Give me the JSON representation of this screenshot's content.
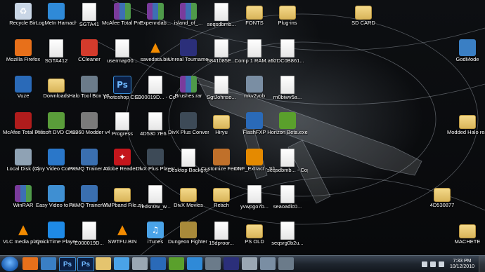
{
  "desktop_icons": [
    {
      "label": "Recycle Bin",
      "icon": "recycle-bin-icon",
      "color": "#c9d6e6"
    },
    {
      "label": "Mozilla Firefox",
      "icon": "firefox-icon",
      "color": "#e8701a"
    },
    {
      "label": "Vuze",
      "icon": "vuze-icon",
      "color": "#2a6ab8"
    },
    {
      "label": "McAfee Total Protection ...",
      "icon": "mcafee-icon",
      "color": "#b01c1c"
    },
    {
      "label": "Local Disk (C)",
      "icon": "drive-icon",
      "color": "#8fa2b4"
    },
    {
      "label": "WinRAR",
      "icon": "winrar-icon",
      "color": "#7a3b9c"
    },
    {
      "label": "VLC media player",
      "icon": "vlc-icon",
      "color": "#f28b00"
    },
    {
      "label": "LogMeIn Hamachi",
      "icon": "hamachi-icon",
      "color": "#2f8ad8"
    },
    {
      "label": "SGTA412",
      "icon": "file-icon",
      "color": "#ffffff"
    },
    {
      "label": "Downloads",
      "icon": "folder-icon",
      "color": "#e5c46e"
    },
    {
      "label": "Xilisoft DVD Creator 6",
      "icon": "dvd-icon",
      "color": "#5a9d3a"
    },
    {
      "label": "Any Video Converter ...",
      "icon": "video-converter-icon",
      "color": "#2a77c9"
    },
    {
      "label": "Easy Video to Audio Con...",
      "icon": "audio-converter-icon",
      "color": "#3f8fd2"
    },
    {
      "label": "QuickTime Player",
      "icon": "quicktime-icon",
      "color": "#1e8ae6"
    },
    {
      "label": "SGTA41",
      "icon": "file-icon",
      "color": "#ffffff"
    },
    {
      "label": "CCleaner",
      "icon": "ccleaner-icon",
      "color": "#d33b2c"
    },
    {
      "label": "Halo Tool Box V3.5",
      "icon": "halo-icon",
      "color": "#6b7b8a"
    },
    {
      "label": "X8360 Modder v4.0",
      "icon": "modder-icon",
      "color": "#7a7a7a"
    },
    {
      "label": "PKMQ Trainer XL",
      "icon": "trainer-icon",
      "color": "#3a6fb0"
    },
    {
      "label": "PKMQ Trainer XL",
      "icon": "trainer-icon",
      "color": "#3a6fb0"
    },
    {
      "label": "E000019D...",
      "icon": "file-icon",
      "color": "#ffffff"
    },
    {
      "label": "McAfee Total Protection ...",
      "icon": "winrar-icon",
      "color": "#7a3b9c"
    },
    {
      "label": "usermap00...",
      "icon": "file-icon",
      "color": "#ffffff"
    },
    {
      "label": "Photoshop CS3",
      "icon": "photoshop-icon",
      "color": "#0b1f44"
    },
    {
      "label": "Progress",
      "icon": "file-icon",
      "color": "#ffffff"
    },
    {
      "label": "Adobe Reader 9",
      "icon": "acrobat-icon",
      "color": "#c4161c"
    },
    {
      "label": "WMPband File.zip",
      "icon": "zip-icon",
      "color": "#e5c46e"
    },
    {
      "label": "SWTFU.BIN",
      "icon": "vlc-icon",
      "color": "#f28b00"
    },
    {
      "label": "Expenndab...",
      "icon": "winrar-icon",
      "color": "#7a3b9c"
    },
    {
      "label": "savedata.bin",
      "icon": "vlc-icon",
      "color": "#f28b00"
    },
    {
      "label": "E000019D... - Copy",
      "icon": "file-icon",
      "color": "#ffffff"
    },
    {
      "label": "4D530 7E6...",
      "icon": "file-icon",
      "color": "#ffffff"
    },
    {
      "label": "DivX Plus Player",
      "icon": "divx-player-icon",
      "color": "#3d4a57"
    },
    {
      "label": "redsn0w_w...",
      "icon": "file-icon",
      "color": "#ffffff"
    },
    {
      "label": "iTunes",
      "icon": "itunes-icon",
      "color": "#4aa3e8"
    },
    {
      "label": "island_of_...",
      "icon": "winrar-icon",
      "color": "#7a3b9c"
    },
    {
      "label": "Unreal Tournament ...",
      "icon": "unreal-icon",
      "color": "#2b2f7a"
    },
    {
      "label": "Brushes.rar",
      "icon": "winrar-icon",
      "color": "#7a3b9c"
    },
    {
      "label": "DivX Plus Converter",
      "icon": "divx-converter-icon",
      "color": "#3d4a57"
    },
    {
      "label": "Desktop Backgroun...",
      "icon": "file-icon",
      "color": "#ffffff"
    },
    {
      "label": "DivX Movies",
      "icon": "folder-icon",
      "color": "#e5c46e"
    },
    {
      "label": "Dungeon Fighter ...",
      "icon": "game-icon",
      "color": "#a88a3a"
    },
    {
      "label": "seqsdbmb...",
      "icon": "file-icon",
      "color": "#ffffff"
    },
    {
      "label": "5841085E...",
      "icon": "file-icon",
      "color": "#ffffff"
    },
    {
      "label": "SgtJohnso...",
      "icon": "file-icon",
      "color": "#ffffff"
    },
    {
      "label": "Hiryu",
      "icon": "folder-icon",
      "color": "#e5c46e"
    },
    {
      "label": "Customize Fences",
      "icon": "fences-icon",
      "color": "#c0702a"
    },
    {
      "label": "Reach",
      "icon": "folder-icon",
      "color": "#e5c46e"
    },
    {
      "label": "15dproor...",
      "icon": "file-icon",
      "color": "#ffffff"
    },
    {
      "label": "FONTS",
      "icon": "folder-icon",
      "color": "#e5c46e"
    },
    {
      "label": "Comp 1 RAM.avi",
      "icon": "file-icon",
      "color": "#ffffff"
    },
    {
      "label": "mkv2vob",
      "icon": "mkv2vob-icon",
      "color": "#7a8ea3"
    },
    {
      "label": "FlashFXP",
      "icon": "flashfxp-icon",
      "color": "#2a6ab8"
    },
    {
      "label": "DNF_Extract - Shortcut",
      "icon": "dnf-icon",
      "color": "#e58a00"
    },
    {
      "label": "yvwpgo7b...",
      "icon": "file-icon",
      "color": "#ffffff"
    },
    {
      "label": "PS OLD",
      "icon": "folder-icon",
      "color": "#e5c46e"
    },
    {
      "label": "Plug-ins",
      "icon": "folder-icon",
      "color": "#e5c46e"
    },
    {
      "label": "52DC0B861...",
      "icon": "file-icon",
      "color": "#ffffff"
    },
    {
      "label": "rn0biwv5a...",
      "icon": "file-icon",
      "color": "#ffffff"
    },
    {
      "label": "Horizon Beta.exe",
      "icon": "horizon-icon",
      "color": "#5aa02c"
    },
    {
      "label": "seqsdbmb... - Copy",
      "icon": "file-icon",
      "color": "#ffffff"
    },
    {
      "label": "seaoadlc0...",
      "icon": "file-icon",
      "color": "#ffffff"
    },
    {
      "label": "seqsrg0b2u...",
      "icon": "file-icon",
      "color": "#ffffff"
    },
    {
      "label": "SD CARD",
      "icon": "folder-icon",
      "color": "#e5c46e"
    },
    {
      "label": "GodMode",
      "icon": "control-panel-icon",
      "color": "#3a7fc4"
    },
    {
      "label": "Modded Halo rea...",
      "icon": "folder-icon",
      "color": "#e5c46e"
    },
    {
      "label": "4D530877",
      "icon": "folder-icon",
      "color": "#e5c46e"
    },
    {
      "label": "MACHETE",
      "icon": "folder-icon",
      "color": "#e5c46e"
    }
  ],
  "taskbar": {
    "pinned": [
      {
        "icon": "firefox-icon",
        "color": "#e8701a"
      },
      {
        "icon": "media-player-icon",
        "color": "#3a7fc4"
      },
      {
        "icon": "photoshop-icon",
        "color": "#0b1f44"
      },
      {
        "icon": "photoshop-icon",
        "color": "#0b1f44"
      },
      {
        "icon": "explorer-icon",
        "color": "#e5c46e"
      },
      {
        "icon": "media-icon",
        "color": "#4aa3e8"
      },
      {
        "icon": "app-icon",
        "color": "#9aa7b3"
      },
      {
        "icon": "wmp-icon",
        "color": "#2a6ab8"
      },
      {
        "icon": "xbox-icon",
        "color": "#5aa02c"
      },
      {
        "icon": "messenger-icon",
        "color": "#2f8ad8"
      },
      {
        "icon": "app-icon",
        "color": "#6b7b8a"
      },
      {
        "icon": "unreal-icon",
        "color": "#2b2f7a"
      },
      {
        "icon": "network-icon",
        "color": "#9aa7b3"
      },
      {
        "icon": "app-icon",
        "color": "#7a8ea3"
      },
      {
        "icon": "halo-icon",
        "color": "#6b7b8a"
      }
    ],
    "clock_time": "7:33 PM",
    "clock_date": "10/12/2010"
  }
}
